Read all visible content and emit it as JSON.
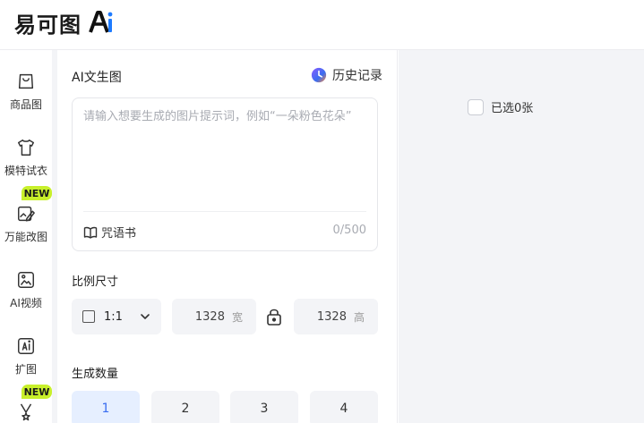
{
  "brand": {
    "name": "易可图",
    "ai_mark": "Ai",
    "colors": {
      "ai_blue": "#1e7bff",
      "ai_dark": "#111111"
    }
  },
  "sidebar": {
    "items": [
      {
        "label": "商品图",
        "icon": "bag-icon"
      },
      {
        "label": "模特试衣",
        "icon": "tshirt-icon"
      },
      {
        "label": "万能改图",
        "icon": "edit-image-icon",
        "badge": "NEW"
      },
      {
        "label": "AI视频",
        "icon": "video-icon"
      },
      {
        "label": "扩图",
        "icon": "expand-image-icon"
      },
      {
        "label": "",
        "icon": "medal-icon",
        "badge": "NEW"
      }
    ],
    "badge_color": "#c8f02b"
  },
  "panel": {
    "title": "AI文生图",
    "history_label": "历史记录",
    "prompt": {
      "value": "",
      "placeholder": "请输入想要生成的图片提示词，例如“一朵粉色花朵”",
      "spell_book_label": "咒语书",
      "char_count": "0/500"
    },
    "ratio": {
      "section_label": "比例尺寸",
      "selected": "1:1",
      "width_value": "1328",
      "width_unit": "宽",
      "height_value": "1328",
      "height_unit": "高"
    },
    "count": {
      "section_label": "生成数量",
      "options": [
        "1",
        "2",
        "3",
        "4"
      ],
      "selected": "1",
      "accent_color": "#3a6df0"
    }
  },
  "gallery": {
    "selected_label": "已选0张"
  }
}
